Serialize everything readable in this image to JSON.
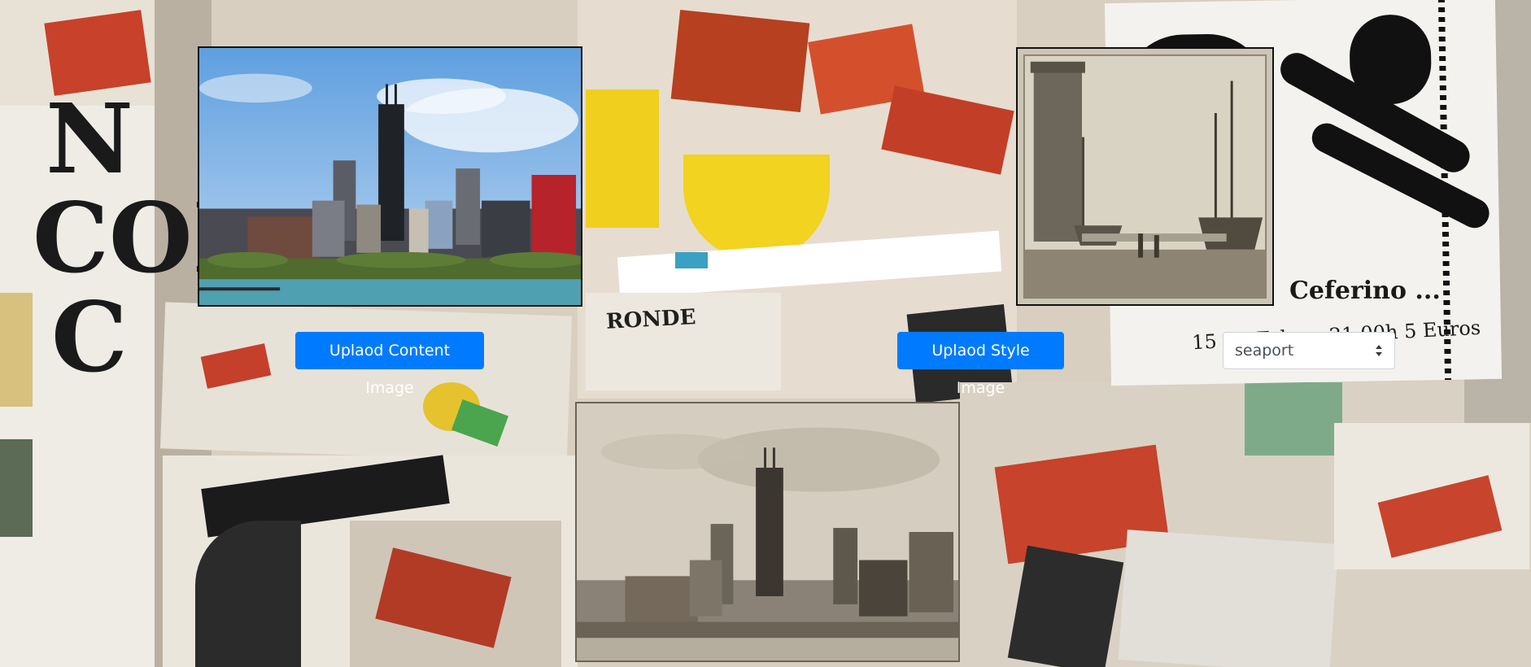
{
  "content_upload": {
    "label": "Uplaod Content Image"
  },
  "style_upload": {
    "label": "Uplaod Style Image"
  },
  "style_select": {
    "selected": "seaport"
  },
  "background": {
    "scrap_letters": "N\nCON\nC",
    "poster_title": "Ceferino ...",
    "poster_subtitle": "15 De Febrer 21:00h 5 Euros",
    "scrap_word": "RONDE"
  },
  "colors": {
    "button_blue": "#007bff",
    "button_text": "#ffffff",
    "select_text": "#495057"
  }
}
